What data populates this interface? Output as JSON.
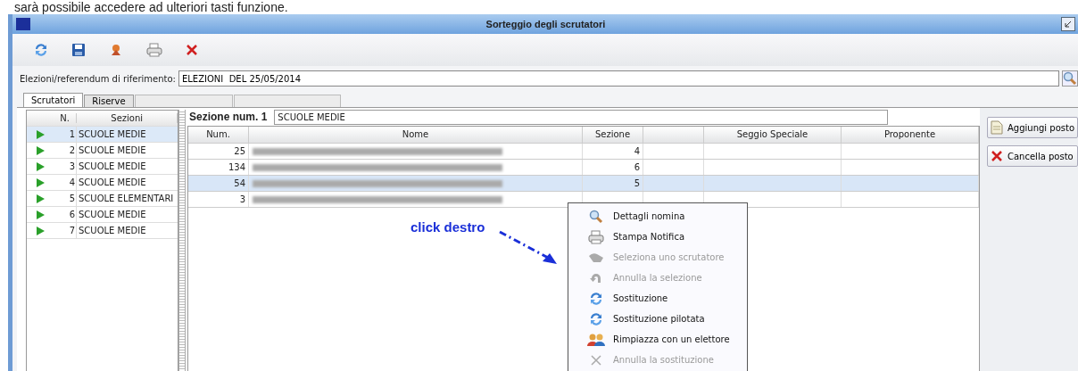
{
  "caption": "sarà possibile accedere ad ulteriori tasti funzione.",
  "window": {
    "title": "Sorteggio degli scrutatori"
  },
  "toolbar": [
    {
      "kind": "refresh"
    },
    {
      "kind": "save"
    },
    {
      "kind": "draw"
    },
    {
      "kind": "print"
    },
    {
      "kind": "delete"
    }
  ],
  "reference_field": {
    "label": "Elezioni/referendum di riferimento:",
    "value": "ELEZIONI  DEL 25/05/2014"
  },
  "tabs": [
    {
      "label": "Scrutatori",
      "selected": true,
      "disabled": false
    },
    {
      "label": "Riserve",
      "selected": false,
      "disabled": false
    },
    {
      "selected": false,
      "disabled": true
    },
    {
      "selected": false,
      "disabled": true
    }
  ],
  "sections": {
    "columns": [
      "N.",
      "Sezioni"
    ],
    "rows": [
      {
        "n": "1",
        "name": "SCUOLE MEDIE",
        "selected": true
      },
      {
        "n": "2",
        "name": "SCUOLE MEDIE",
        "selected": false
      },
      {
        "n": "3",
        "name": "SCUOLE MEDIE",
        "selected": false
      },
      {
        "n": "4",
        "name": "SCUOLE MEDIE",
        "selected": false
      },
      {
        "n": "5",
        "name": "SCUOLE ELEMENTARI",
        "selected": false
      },
      {
        "n": "6",
        "name": "SCUOLE MEDIE",
        "selected": false
      },
      {
        "n": "7",
        "name": "SCUOLE MEDIE",
        "selected": false
      }
    ]
  },
  "section_header": {
    "label": "Sezione num. 1",
    "value": "SCUOLE MEDIE"
  },
  "table": {
    "columns": [
      "Num.",
      "Nome",
      "Sezione",
      "",
      "Seggio Speciale",
      "Proponente"
    ],
    "rows": [
      {
        "num": "25",
        "sezione": "4",
        "selected": false
      },
      {
        "num": "134",
        "sezione": "6",
        "selected": false
      },
      {
        "num": "54",
        "sezione": "5",
        "selected": true
      },
      {
        "num": "3",
        "selected": false
      }
    ]
  },
  "side_buttons": [
    {
      "kind": "add",
      "label": "Aggiungi posto"
    },
    {
      "kind": "delete",
      "label": "Cancella posto"
    }
  ],
  "annotation": "click destro",
  "context_menu": [
    {
      "kind": "search",
      "label": "Dettagli nomina",
      "disabled": false
    },
    {
      "kind": "print",
      "label": "Stampa Notifica",
      "disabled": false
    },
    {
      "kind": "select",
      "label": "Seleziona uno scrutatore",
      "disabled": true
    },
    {
      "kind": "undo",
      "label": "Annulla la selezione",
      "disabled": true
    },
    {
      "kind": "swap",
      "label": "Sostituzione",
      "disabled": false
    },
    {
      "kind": "swap",
      "label": "Sostituzione pilotata",
      "disabled": false
    },
    {
      "kind": "people",
      "label": "Rimpiazza con un elettore",
      "disabled": false
    },
    {
      "kind": "cross",
      "label": "Annulla la sostituzione",
      "disabled": true
    }
  ]
}
